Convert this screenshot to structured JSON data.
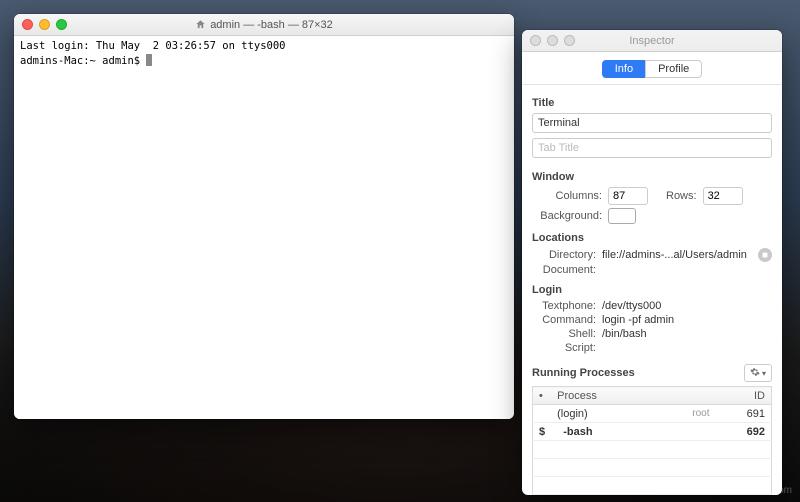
{
  "watermark": "wsidn.com",
  "terminal": {
    "title": "admin — -bash — 87×32",
    "last_login": "Last login: Thu May  2 03:26:57 on ttys000",
    "prompt": "admins-Mac:~ admin$ "
  },
  "inspector": {
    "title": "Inspector",
    "tabs": {
      "info": "Info",
      "profile": "Profile"
    },
    "sections": {
      "title": "Title",
      "window": "Window",
      "locations": "Locations",
      "login": "Login",
      "processes": "Running Processes"
    },
    "title_group": {
      "title_value": "Terminal",
      "tab_placeholder": "Tab Title"
    },
    "window": {
      "columns_label": "Columns:",
      "columns_value": "87",
      "rows_label": "Rows:",
      "rows_value": "32",
      "background_label": "Background:"
    },
    "locations": {
      "directory_label": "Directory:",
      "directory_value": "file://admins-...al/Users/admin",
      "document_label": "Document:"
    },
    "login": {
      "textphone_label": "Textphone:",
      "textphone_value": "/dev/ttys000",
      "command_label": "Command:",
      "command_value": "login -pf admin",
      "shell_label": "Shell:",
      "shell_value": "/bin/bash",
      "script_label": "Script:"
    },
    "processes": {
      "columns": {
        "process": "Process",
        "id": "ID"
      },
      "rows": [
        {
          "indent": false,
          "marker": "",
          "name": "(login)",
          "note": "root",
          "pid": "691",
          "bold": false
        },
        {
          "indent": true,
          "marker": "$",
          "name": "-bash",
          "note": "",
          "pid": "692",
          "bold": true
        }
      ]
    }
  }
}
